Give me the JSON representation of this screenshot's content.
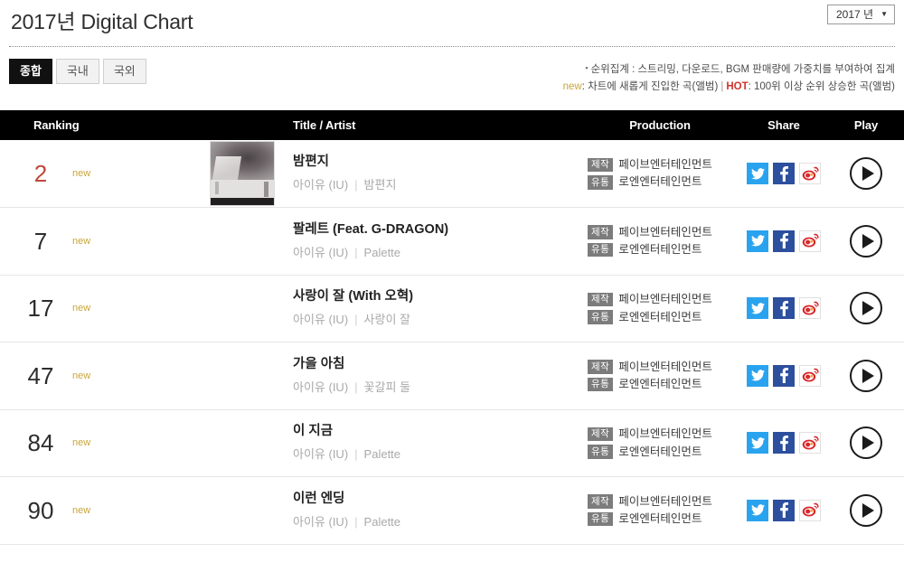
{
  "header": {
    "title": "2017년 Digital Chart",
    "year_select": {
      "value": "2017 년",
      "caret": "▼"
    }
  },
  "tabs": [
    {
      "label": "종합",
      "active": true
    },
    {
      "label": "국내",
      "active": false
    },
    {
      "label": "국외",
      "active": false
    }
  ],
  "legend": {
    "bullet": "▪",
    "line1": "순위집계 : 스트리밍, 다운로드, BGM 판매량에 가중치를 부여하여 집계",
    "new_tag": "new",
    "new_desc": ": 차트에 새롭게 진입한 곡(앨범)",
    "separator": "|",
    "hot_tag": "HOT",
    "hot_desc": ": 100위 이상 순위 상승한 곡(앨범)",
    "colors": {
      "new": "#c8a63e",
      "hot": "#d0342c"
    }
  },
  "table": {
    "columns": [
      "Ranking",
      "Title / Artist",
      "Production",
      "Share",
      "Play"
    ],
    "badge_labels": {
      "production": "제작",
      "distribution": "유통"
    },
    "rows": [
      {
        "rank": "2",
        "rank_highlight": true,
        "status": "new",
        "has_thumb": true,
        "title": "밤편지",
        "artist": "아이유 (IU)",
        "album": "밤편지",
        "production": "페이브엔터테인먼트",
        "distribution": "로엔엔터테인먼트"
      },
      {
        "rank": "7",
        "rank_highlight": false,
        "status": "new",
        "has_thumb": false,
        "title": "팔레트 (Feat. G-DRAGON)",
        "artist": "아이유 (IU)",
        "album": "Palette",
        "production": "페이브엔터테인먼트",
        "distribution": "로엔엔터테인먼트"
      },
      {
        "rank": "17",
        "rank_highlight": false,
        "status": "new",
        "has_thumb": false,
        "title": "사랑이 잘 (With 오혁)",
        "artist": "아이유 (IU)",
        "album": "사랑이 잘",
        "production": "페이브엔터테인먼트",
        "distribution": "로엔엔터테인먼트"
      },
      {
        "rank": "47",
        "rank_highlight": false,
        "status": "new",
        "has_thumb": false,
        "title": "가을 아침",
        "artist": "아이유 (IU)",
        "album": "꽃갈피 둘",
        "production": "페이브엔터테인먼트",
        "distribution": "로엔엔터테인먼트"
      },
      {
        "rank": "84",
        "rank_highlight": false,
        "status": "new",
        "has_thumb": false,
        "title": "이 지금",
        "artist": "아이유 (IU)",
        "album": "Palette",
        "production": "페이브엔터테인먼트",
        "distribution": "로엔엔터테인먼트"
      },
      {
        "rank": "90",
        "rank_highlight": false,
        "status": "new",
        "has_thumb": false,
        "title": "이런 엔딩",
        "artist": "아이유 (IU)",
        "album": "Palette",
        "production": "페이브엔터테인먼트",
        "distribution": "로엔엔터테인먼트"
      }
    ]
  },
  "share_icons": [
    {
      "name": "twitter-share-icon",
      "color": "#2aa3ef"
    },
    {
      "name": "facebook-share-icon",
      "color": "#2c4f9e"
    },
    {
      "name": "weibo-share-icon",
      "color": "#d8272c"
    }
  ],
  "play_icon": "play-icon"
}
